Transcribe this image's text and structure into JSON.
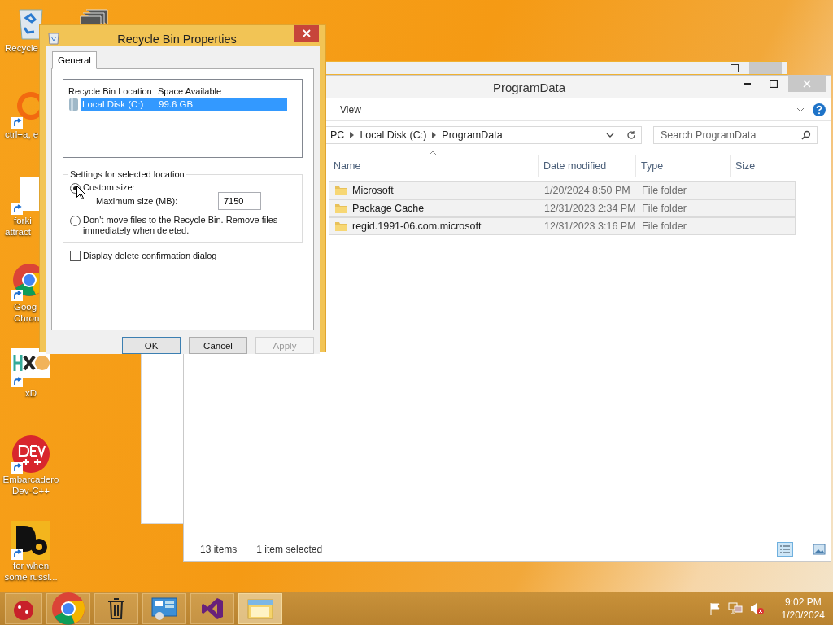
{
  "desktop_icons": [
    {
      "kind": "recycle-bin",
      "shortcut": false,
      "lines": [
        "Recycle"
      ]
    },
    {
      "kind": "ring",
      "shortcut": true,
      "lines": [
        "ctrl+a, e"
      ]
    },
    {
      "kind": "document",
      "shortcut": true,
      "lines": [
        "forki",
        "attract"
      ]
    },
    {
      "kind": "chrome",
      "shortcut": true,
      "lines": [
        "Goog",
        "Chron"
      ]
    },
    {
      "kind": "xd",
      "shortcut": true,
      "lines": [
        "xD"
      ]
    },
    {
      "kind": "devcpp",
      "shortcut": true,
      "lines": [
        "Embarcadero",
        "Dev-C++"
      ]
    },
    {
      "kind": "de",
      "shortcut": true,
      "lines": [
        "for when",
        "some russi..."
      ]
    }
  ],
  "dialog": {
    "title": "Recycle Bin Properties",
    "tabs": [
      {
        "label": "General",
        "selected": true
      }
    ],
    "locations": {
      "columns": [
        "Recycle Bin Location",
        "Space Available"
      ],
      "rows": [
        {
          "location": "Local Disk (C:)",
          "space": "99.6 GB",
          "selected": true
        }
      ]
    },
    "settings": {
      "title": "Settings for selected location",
      "options": [
        {
          "label": "Custom size:",
          "selected": true
        },
        {
          "label": "Don't move files to the Recycle Bin. Remove files immediately when deleted.",
          "selected": false
        }
      ],
      "max_size_label": "Maximum size (MB):",
      "max_size_value": "7150"
    },
    "confirm": {
      "label": "Display delete confirmation dialog",
      "checked": false
    },
    "buttons": [
      {
        "label": "OK",
        "disabled": false
      },
      {
        "label": "Cancel",
        "disabled": false
      },
      {
        "label": "Apply",
        "disabled": true
      }
    ]
  },
  "explorer": {
    "title": "ProgramData",
    "ribbon_tabs": [
      "View"
    ],
    "breadcrumb": [
      "PC",
      "Local Disk (C:)",
      "ProgramData"
    ],
    "search": {
      "placeholder": "Search ProgramData"
    },
    "columns": [
      "Name",
      "Date modified",
      "Type",
      "Size"
    ],
    "rows": [
      {
        "name": "Microsoft",
        "date": "1/20/2024 8:50 PM",
        "type": "File folder",
        "selected": false
      },
      {
        "name": "Package Cache",
        "date": "12/31/2023 2:34 PM",
        "type": "File folder",
        "selected": false
      },
      {
        "name": "regid.1991-06.com.microsoft",
        "date": "12/31/2023 3:16 PM",
        "type": "File folder",
        "selected": false
      }
    ],
    "status": {
      "count": "13 items",
      "selection": "1 item selected"
    }
  },
  "taskbar": {
    "apps": [
      {
        "kind": "ornament",
        "active": false
      },
      {
        "kind": "chrome",
        "active": false
      },
      {
        "kind": "trash",
        "active": false
      },
      {
        "kind": "control-panel",
        "active": false
      },
      {
        "kind": "visual-studio",
        "active": false
      },
      {
        "kind": "explorer",
        "active": true
      }
    ],
    "time": "9:02 PM",
    "date": "1/20/2024"
  }
}
